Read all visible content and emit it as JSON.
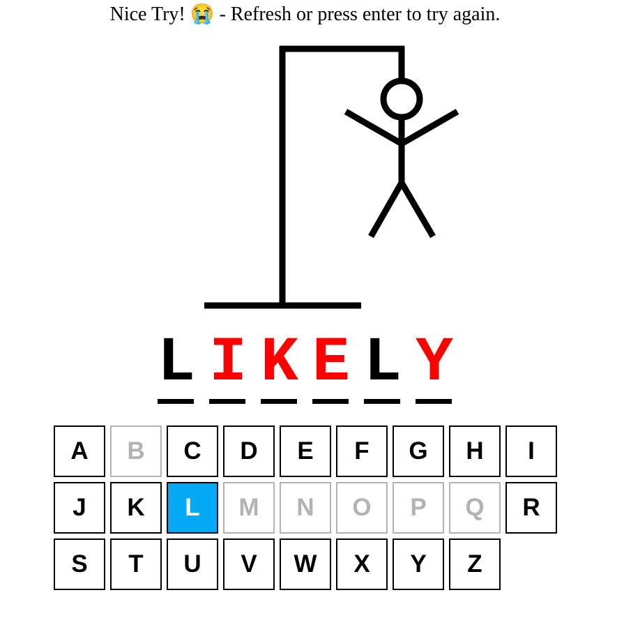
{
  "message": "Nice Try! 😭 - Refresh or press enter to try again.",
  "word": {
    "letters": [
      {
        "char": "L",
        "status": "guessed"
      },
      {
        "char": "I",
        "status": "missed"
      },
      {
        "char": "K",
        "status": "missed"
      },
      {
        "char": "E",
        "status": "missed"
      },
      {
        "char": "L",
        "status": "guessed"
      },
      {
        "char": "Y",
        "status": "missed"
      }
    ]
  },
  "keyboard": {
    "keys": [
      {
        "letter": "A",
        "state": "available"
      },
      {
        "letter": "B",
        "state": "used"
      },
      {
        "letter": "C",
        "state": "available"
      },
      {
        "letter": "D",
        "state": "available"
      },
      {
        "letter": "E",
        "state": "available"
      },
      {
        "letter": "F",
        "state": "available"
      },
      {
        "letter": "G",
        "state": "available"
      },
      {
        "letter": "H",
        "state": "available"
      },
      {
        "letter": "I",
        "state": "available"
      },
      {
        "letter": "J",
        "state": "available"
      },
      {
        "letter": "K",
        "state": "available"
      },
      {
        "letter": "L",
        "state": "selected"
      },
      {
        "letter": "M",
        "state": "used"
      },
      {
        "letter": "N",
        "state": "used"
      },
      {
        "letter": "O",
        "state": "used"
      },
      {
        "letter": "P",
        "state": "used"
      },
      {
        "letter": "Q",
        "state": "used"
      },
      {
        "letter": "R",
        "state": "available"
      },
      {
        "letter": "S",
        "state": "available"
      },
      {
        "letter": "T",
        "state": "available"
      },
      {
        "letter": "U",
        "state": "available"
      },
      {
        "letter": "V",
        "state": "available"
      },
      {
        "letter": "W",
        "state": "available"
      },
      {
        "letter": "X",
        "state": "available"
      },
      {
        "letter": "Y",
        "state": "available"
      },
      {
        "letter": "Z",
        "state": "available"
      }
    ]
  },
  "colors": {
    "missed_letter": "#ff0000",
    "selected_key": "#03a9f4",
    "used_key": "#b3b3b3"
  },
  "hangman": {
    "wrong_guesses": 6,
    "max_guesses": 6
  }
}
